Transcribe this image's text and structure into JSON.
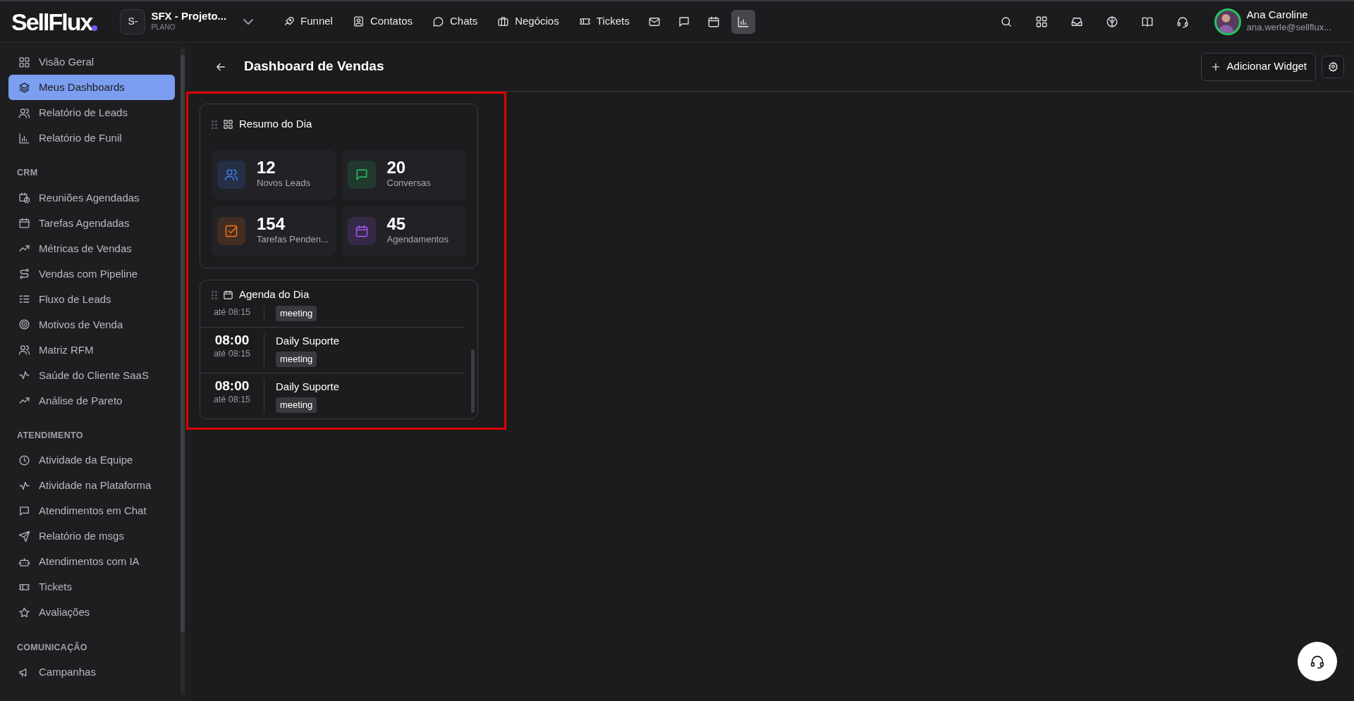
{
  "topbar": {
    "logo": "SellFlux",
    "workspace": {
      "badge": "S-",
      "name": "SFX - Projeto...",
      "plan": "PLANO"
    },
    "nav_links": [
      {
        "label": "Funnel"
      },
      {
        "label": "Contatos"
      },
      {
        "label": "Chats"
      },
      {
        "label": "Negócios"
      },
      {
        "label": "Tickets"
      }
    ],
    "icon_buttons": [
      {
        "selected": false
      },
      {
        "selected": false
      },
      {
        "selected": false
      },
      {
        "selected": true
      }
    ],
    "user": {
      "name": "Ana Caroline",
      "email": "ana.werle@sellflux..."
    }
  },
  "sidebar": {
    "sections": [
      {
        "items": [
          {
            "label": "Visão Geral",
            "selected": false
          },
          {
            "label": "Meus Dashboards",
            "selected": true
          },
          {
            "label": "Relatório de Leads",
            "selected": false
          },
          {
            "label": "Relatório de Funil",
            "selected": false
          }
        ]
      },
      {
        "heading": "CRM",
        "items": [
          {
            "label": "Reuniões Agendadas",
            "selected": false
          },
          {
            "label": "Tarefas Agendadas",
            "selected": false
          },
          {
            "label": "Métricas de Vendas",
            "selected": false
          },
          {
            "label": "Vendas com Pipeline",
            "selected": false
          },
          {
            "label": "Fluxo de Leads",
            "selected": false
          },
          {
            "label": "Motivos de Venda",
            "selected": false
          },
          {
            "label": "Matriz RFM",
            "selected": false
          },
          {
            "label": "Saúde do Cliente SaaS",
            "selected": false
          },
          {
            "label": "Análise de Pareto",
            "selected": false
          }
        ]
      },
      {
        "heading": "ATENDIMENTO",
        "items": [
          {
            "label": "Atividade da Equipe",
            "selected": false
          },
          {
            "label": "Atividade na Plataforma",
            "selected": false
          },
          {
            "label": "Atendimentos em Chat",
            "selected": false
          },
          {
            "label": "Relatório de msgs",
            "selected": false
          },
          {
            "label": "Atendimentos com IA",
            "selected": false
          },
          {
            "label": "Tickets",
            "selected": false
          },
          {
            "label": "Avaliações",
            "selected": false
          }
        ]
      },
      {
        "heading": "COMUNICAÇÃO",
        "items": [
          {
            "label": "Campanhas",
            "selected": false
          }
        ]
      }
    ]
  },
  "page": {
    "title": "Dashboard de Vendas",
    "add_button": "Adicionar Widget"
  },
  "summary_widget": {
    "title": "Resumo do Dia",
    "tiles": [
      {
        "value": "12",
        "label": "Novos Leads",
        "color": "#3b82f6"
      },
      {
        "value": "20",
        "label": "Conversas",
        "color": "#22c55e"
      },
      {
        "value": "154",
        "label": "Tarefas Penden...",
        "color": "#f97316"
      },
      {
        "value": "45",
        "label": "Agendamentos",
        "color": "#a855f7"
      }
    ]
  },
  "agenda_widget": {
    "title": "Agenda do Dia",
    "events": [
      {
        "until": "até 08:15",
        "tag": "meeting"
      },
      {
        "time": "08:00",
        "until": "até 08:15",
        "title": "Daily Suporte",
        "tag": "meeting"
      },
      {
        "time": "08:00",
        "until": "até 08:15",
        "title": "Daily Suporte",
        "tag": "meeting"
      }
    ]
  }
}
